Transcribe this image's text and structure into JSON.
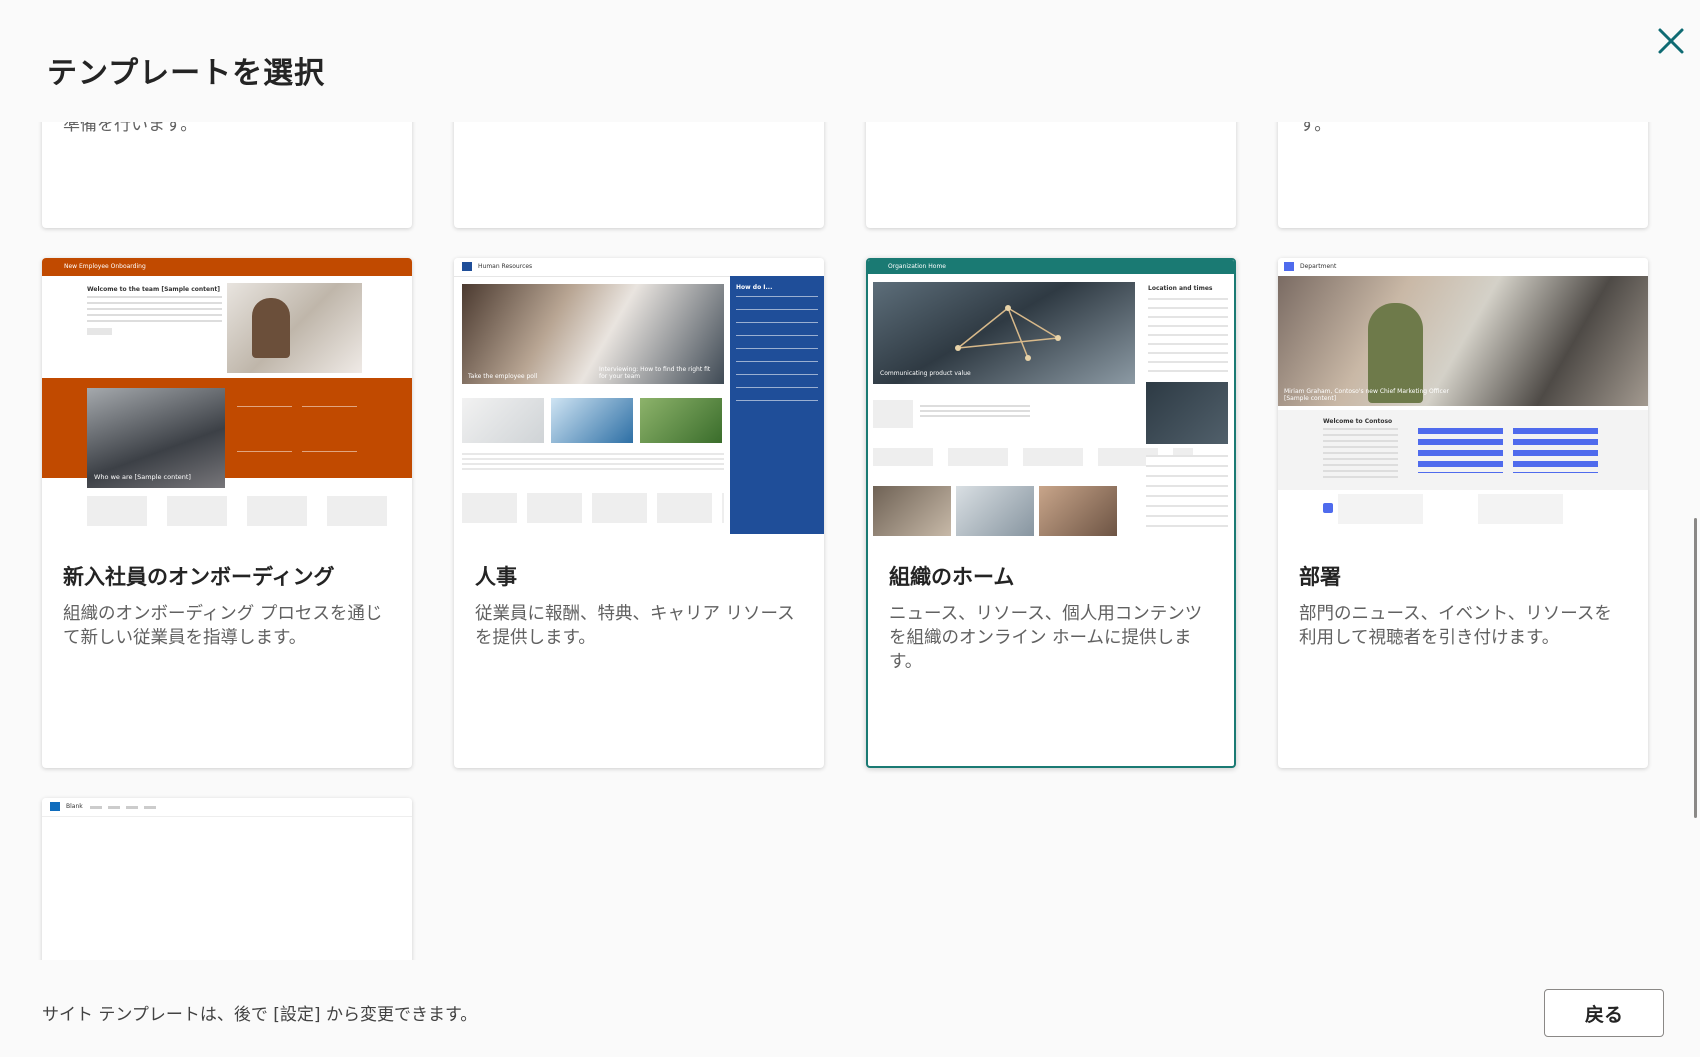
{
  "dialog": {
    "title": "テンプレートを選択",
    "close_icon": "close-icon"
  },
  "top_row": {
    "card1_text": "準備を行います。",
    "card4_text": "す。"
  },
  "cards": [
    {
      "title": "新入社員のオンボーディング",
      "description": "組織のオンボーディング プロセスを通じて新しい従業員を指導します。",
      "thumb": {
        "site_name": "New Employee Onboarding",
        "heading": "Welcome to the team [Sample content]",
        "caption": "Who we are [Sample content]",
        "accent": "#c14a00"
      }
    },
    {
      "title": "人事",
      "description": "従業員に報酬、特典、キャリア リソースを提供します。",
      "thumb": {
        "site_name": "Human Resources",
        "caption1": "Take the employee poll",
        "caption2": "Interviewing: How to find the right fit for your team",
        "side_title": "How do I...",
        "accent": "#1f4e99"
      }
    },
    {
      "title": "組織のホーム",
      "description": "ニュース、リソース、個人用コンテンツを組織のオンライン ホームに提供します。",
      "selected": true,
      "thumb": {
        "site_name": "Organization Home",
        "caption": "Communicating product value",
        "side_title": "Location and times",
        "accent": "#1a7a73"
      }
    },
    {
      "title": "部署",
      "description": "部門のニュース、イベント、リソースを利用して視聴者を引き付けます。",
      "thumb": {
        "site_name": "Department",
        "caption": "Miriam Graham, Contoso's new Chief Marketing Officer [Sample content]",
        "section": "Welcome to Contoso",
        "accent": "#4f6bed"
      }
    },
    {
      "thumb": {
        "site_name": "Blank",
        "accent": "#0f6cbd"
      }
    }
  ],
  "footer": {
    "note": "サイト テンプレートは、後で [設定] から変更できます。",
    "back_label": "戻る"
  }
}
